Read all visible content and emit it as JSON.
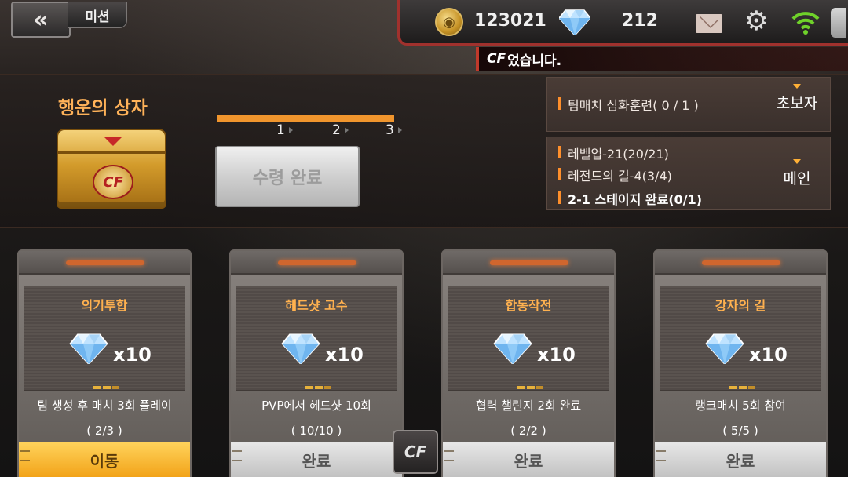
{
  "header": {
    "back_icon": "double-chevron-left-icon",
    "mission_tab": "미션",
    "coins": "123021",
    "gems": "212",
    "coin_icon_glyph": "◉",
    "coin_icon": "coin-icon",
    "gem_icon": "diamond-icon",
    "mail_icon": "mail-icon",
    "settings_icon": "gear-icon",
    "wifi_icon": "wifi-icon",
    "ticker_logo": "CF",
    "ticker_text": "었습니다."
  },
  "lucky_box": {
    "title": "행운의 상자",
    "chest_logo": "CF",
    "progress_fraction": 1.0,
    "steps": [
      "1",
      "2",
      "3"
    ],
    "claim_label": "수령 완료"
  },
  "quests": {
    "beginner": {
      "category": "초보자",
      "lines": [
        "팀매치 심화훈련( 0 / 1 )"
      ]
    },
    "main": {
      "category": "메인",
      "lines": [
        "레벨업-21(20/21)",
        "레전드의 길-4(3/4)",
        "2-1 스테이지 완료(0/1)"
      ]
    }
  },
  "cards": [
    {
      "title": "의기투합",
      "reward": "x10",
      "desc": "팀 생성 후 매치 3회 플레이",
      "count": "( 2/3 )",
      "button": "이동",
      "state": "go"
    },
    {
      "title": "헤드샷 고수",
      "reward": "x10",
      "desc": "PVP에서 헤드샷 10회",
      "count": "( 10/10 )",
      "button": "완료",
      "state": "done"
    },
    {
      "title": "합동작전",
      "reward": "x10",
      "desc": "협력 챌린지 2회 완료",
      "count": "( 2/2 )",
      "button": "완료",
      "state": "done"
    },
    {
      "title": "강자의 길",
      "reward": "x10",
      "desc": "랭크매치 5회 참여",
      "count": "( 5/5 )",
      "button": "완료",
      "state": "done"
    }
  ],
  "center_logo": "CF",
  "colors": {
    "accent_orange": "#ffb14f",
    "button_gold": "#f2a319",
    "red_trim": "#a0312d"
  }
}
